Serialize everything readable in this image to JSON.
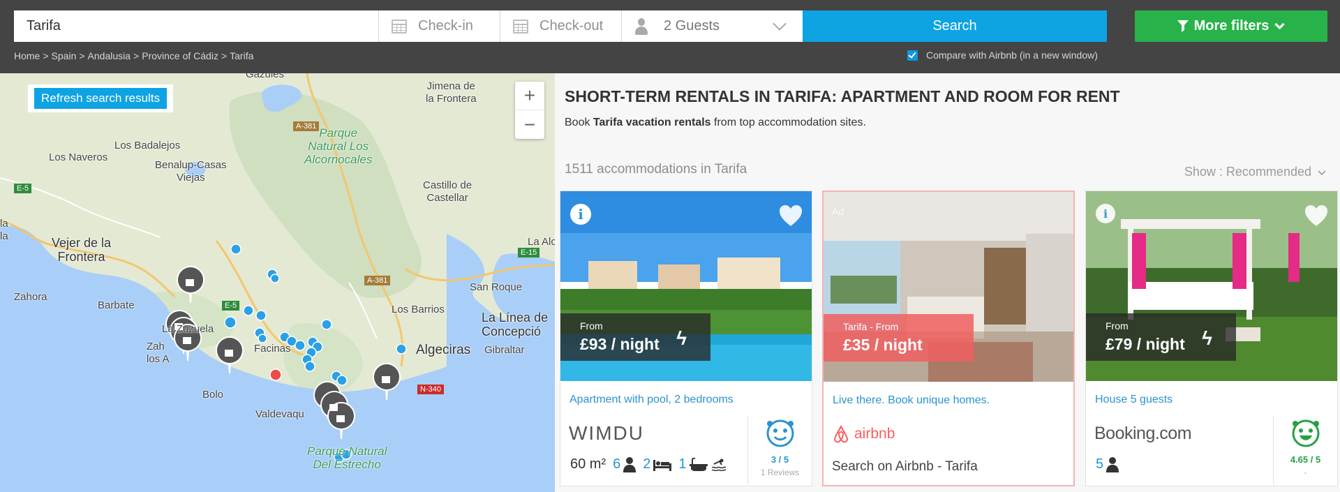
{
  "header": {
    "destination_value": "Tarifa",
    "checkin_placeholder": "Check-in",
    "checkout_placeholder": "Check-out",
    "guests_value": "2 Guests",
    "search_label": "Search",
    "more_filters_label": "More filters",
    "breadcrumb": [
      "Home",
      "Spain",
      "Andalusia",
      "Province of Cádiz",
      "Tarifa"
    ],
    "compare_label": "Compare with Airbnb (in a new window)",
    "compare_checked": true
  },
  "map": {
    "refresh_label": "Refresh search results",
    "zoom_in": "+",
    "zoom_out": "−",
    "places": {
      "gazules": "Gazules",
      "jimena": "Jimena de\nla Frontera",
      "badalejos": "Los Badalejos",
      "naveros": "Los Naveros",
      "benalup": "Benalup-Casas\nViejas",
      "parque_alcornocales": "Parque\nNatural Los\nAlcornocales",
      "castillo": "Castillo de\nCastellar",
      "la_la": "la\nla",
      "vejer": "Vejer de la\nFrontera",
      "la_alcai": "La Alcai",
      "zahora": "Zahora",
      "barbate": "Barbate",
      "san_roque": "San Roque",
      "los_barrios": "Los Barrios",
      "la_linea": "La Línea de\nConcepció",
      "zuzuela": "La Zuzuela",
      "zahara": "Zah\nlos A",
      "facinas": "Facinas",
      "algeciras": "Algeciras",
      "gibraltar": "Gibraltar",
      "bolonia": "Bolo",
      "valdevaqueros": "Valdevaqu",
      "parque_estrecho": "Parque Natural\nDel Estrecho"
    },
    "roads": {
      "a381_top": "A-381",
      "a381_mid": "A-381",
      "e5": "E-5",
      "e15": "E-15",
      "n340": "N-340",
      "e5b": "E-5"
    },
    "colors": {
      "land": "#e4e9d4",
      "water": "#a9cef8",
      "pin": "#555555",
      "dot": "#2aa1e6",
      "selected_dot": "#ef4b4b"
    }
  },
  "results": {
    "title": "SHORT-TERM RENTALS IN TARIFA: APARTMENT AND ROOM FOR RENT",
    "intro_prefix": "Book ",
    "intro_bold": "Tarifa vacation rentals",
    "intro_suffix": " from top accommodation sites.",
    "count_label": "1511 accommodations in Tarifa",
    "sort_label": "Show : Recommended",
    "cards": [
      {
        "price_from": "From",
        "price": "£93 / night",
        "title": "Apartment with pool, 2 bedrooms",
        "brand": "WIMDU",
        "area": "60 m²",
        "guests": "6",
        "beds": "2",
        "baths": "1",
        "rating_score": "3 / 5",
        "rating_reviews": "1 Reviews"
      },
      {
        "ad_label": "Ad",
        "price_from": "Tarifa - From",
        "price": "£35 / night",
        "title": "Live there. Book unique homes.",
        "brand": "airbnb",
        "link": "Search on Airbnb - Tarifa"
      },
      {
        "price_from": "From",
        "price": "£79 / night",
        "title": "House 5 guests",
        "brand_main": "Booking",
        "brand_suffix": ".com",
        "guests": "5",
        "rating_score": "4.65 / 5",
        "rating_reviews": "-"
      }
    ]
  }
}
